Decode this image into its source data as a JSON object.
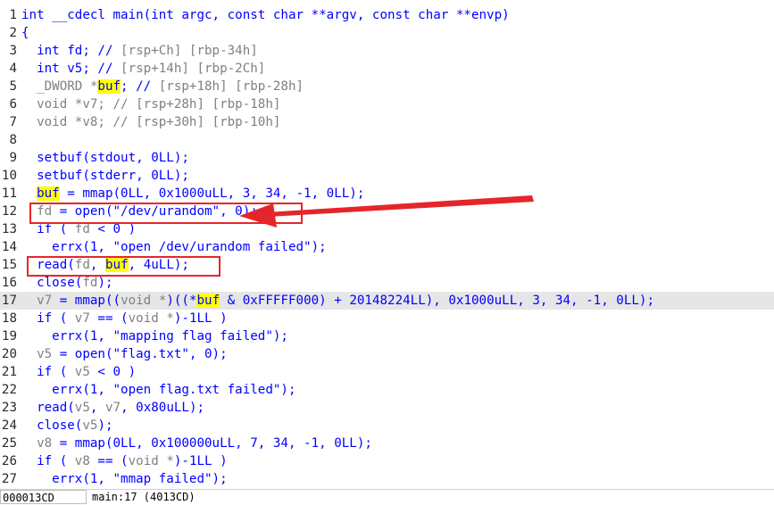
{
  "code_lines": [
    {
      "num": "1",
      "segments": [
        {
          "t": "int __cdecl main(int argc, const char **argv, const char **envp)",
          "c": "b"
        }
      ]
    },
    {
      "num": "2",
      "segments": [
        {
          "t": "{",
          "c": "b"
        }
      ]
    },
    {
      "num": "3",
      "segments": [
        {
          "t": "  int fd; // ",
          "c": "b"
        },
        {
          "t": "[rsp+Ch] [rbp-34h]",
          "c": "g"
        }
      ]
    },
    {
      "num": "4",
      "segments": [
        {
          "t": "  int v5; // ",
          "c": "b"
        },
        {
          "t": "[rsp+14h] [rbp-2Ch]",
          "c": "g"
        }
      ]
    },
    {
      "num": "5",
      "segments": [
        {
          "t": "  _DWORD *",
          "c": "g"
        },
        {
          "t": "buf",
          "c": "hl"
        },
        {
          "t": "; // ",
          "c": "b"
        },
        {
          "t": "[rsp+18h] [rbp-28h]",
          "c": "g"
        }
      ]
    },
    {
      "num": "6",
      "segments": [
        {
          "t": "  void *v7; // ",
          "c": "g"
        },
        {
          "t": "[rsp+28h] [rbp-18h]",
          "c": "g"
        }
      ]
    },
    {
      "num": "7",
      "segments": [
        {
          "t": "  void *v8; // ",
          "c": "g"
        },
        {
          "t": "[rsp+30h] [rbp-10h]",
          "c": "g"
        }
      ]
    },
    {
      "num": "8",
      "segments": []
    },
    {
      "num": "9",
      "segments": [
        {
          "t": "  setbuf(stdout, 0LL);",
          "c": "b"
        }
      ]
    },
    {
      "num": "10",
      "segments": [
        {
          "t": "  setbuf(stderr, 0LL);",
          "c": "b"
        }
      ]
    },
    {
      "num": "11",
      "segments": [
        {
          "t": "  ",
          "c": "b"
        },
        {
          "t": "buf",
          "c": "hl"
        },
        {
          "t": " = mmap(0LL, 0x1000uLL, 3, 34, -1, 0LL);",
          "c": "b"
        }
      ]
    },
    {
      "num": "12",
      "segments": [
        {
          "t": "  ",
          "c": "b"
        },
        {
          "t": "fd",
          "c": "g"
        },
        {
          "t": " = open(\"/dev/urandom\", 0);",
          "c": "b"
        }
      ]
    },
    {
      "num": "13",
      "segments": [
        {
          "t": "  if ( ",
          "c": "b"
        },
        {
          "t": "fd",
          "c": "g"
        },
        {
          "t": " < 0 )",
          "c": "b"
        }
      ]
    },
    {
      "num": "14",
      "segments": [
        {
          "t": "    errx(1, \"open /dev/urandom failed\");",
          "c": "b"
        }
      ]
    },
    {
      "num": "15",
      "segments": [
        {
          "t": "  read(",
          "c": "b"
        },
        {
          "t": "fd",
          "c": "g"
        },
        {
          "t": ", ",
          "c": "b"
        },
        {
          "t": "buf",
          "c": "hl"
        },
        {
          "t": ", 4uLL);",
          "c": "b"
        }
      ]
    },
    {
      "num": "16",
      "segments": [
        {
          "t": "  close(",
          "c": "b"
        },
        {
          "t": "fd",
          "c": "g"
        },
        {
          "t": ");",
          "c": "b"
        }
      ]
    },
    {
      "num": "17",
      "segments": [
        {
          "t": "  ",
          "c": "b"
        },
        {
          "t": "v7",
          "c": "g"
        },
        {
          "t": " = mmap((",
          "c": "b"
        },
        {
          "t": "void *",
          "c": "g"
        },
        {
          "t": ")((*",
          "c": "b"
        },
        {
          "t": "buf",
          "c": "hl"
        },
        {
          "t": " & 0xFFFFF000) + 20148224LL), 0x1000uLL, 3, 34, -1, 0LL);",
          "c": "b"
        }
      ]
    },
    {
      "num": "18",
      "segments": [
        {
          "t": "  if ( ",
          "c": "b"
        },
        {
          "t": "v7",
          "c": "g"
        },
        {
          "t": " == (",
          "c": "b"
        },
        {
          "t": "void *",
          "c": "g"
        },
        {
          "t": ")-1LL )",
          "c": "b"
        }
      ]
    },
    {
      "num": "19",
      "segments": [
        {
          "t": "    errx(1, \"mapping flag failed\");",
          "c": "b"
        }
      ]
    },
    {
      "num": "20",
      "segments": [
        {
          "t": "  ",
          "c": "b"
        },
        {
          "t": "v5",
          "c": "g"
        },
        {
          "t": " = open(\"flag.txt\", 0);",
          "c": "b"
        }
      ]
    },
    {
      "num": "21",
      "segments": [
        {
          "t": "  if ( ",
          "c": "b"
        },
        {
          "t": "v5",
          "c": "g"
        },
        {
          "t": " < 0 )",
          "c": "b"
        }
      ]
    },
    {
      "num": "22",
      "segments": [
        {
          "t": "    errx(1, \"open flag.txt failed\");",
          "c": "b"
        }
      ]
    },
    {
      "num": "23",
      "segments": [
        {
          "t": "  read(",
          "c": "b"
        },
        {
          "t": "v5",
          "c": "g"
        },
        {
          "t": ", ",
          "c": "b"
        },
        {
          "t": "v7",
          "c": "g"
        },
        {
          "t": ", 0x80uLL);",
          "c": "b"
        }
      ]
    },
    {
      "num": "24",
      "segments": [
        {
          "t": "  close(",
          "c": "b"
        },
        {
          "t": "v5",
          "c": "g"
        },
        {
          "t": ");",
          "c": "b"
        }
      ]
    },
    {
      "num": "25",
      "segments": [
        {
          "t": "  ",
          "c": "b"
        },
        {
          "t": "v8",
          "c": "g"
        },
        {
          "t": " = mmap(0LL, 0x100000uLL, 7, 34, -1, 0LL);",
          "c": "b"
        }
      ]
    },
    {
      "num": "26",
      "segments": [
        {
          "t": "  if ( ",
          "c": "b"
        },
        {
          "t": "v8",
          "c": "g"
        },
        {
          "t": " == (",
          "c": "b"
        },
        {
          "t": "void *",
          "c": "g"
        },
        {
          "t": ")-1LL )",
          "c": "b"
        }
      ]
    },
    {
      "num": "27",
      "segments": [
        {
          "t": "    errx(1, \"mmap failed\");",
          "c": "b"
        }
      ]
    }
  ],
  "current_line": "17",
  "status_bar": {
    "address": "000013CD",
    "location": "main:17 (4013CD)"
  },
  "annotations": [
    {
      "name": "annotation-box-open-urandom",
      "target_line": "12"
    },
    {
      "name": "annotation-box-read-fd",
      "target_line": "15"
    }
  ],
  "colors": {
    "code_text": "#0000ff",
    "comment": "#808080",
    "highlight": "#ffff00",
    "current_line_bg": "#e6e6e6",
    "annotation": "#e4262b"
  }
}
